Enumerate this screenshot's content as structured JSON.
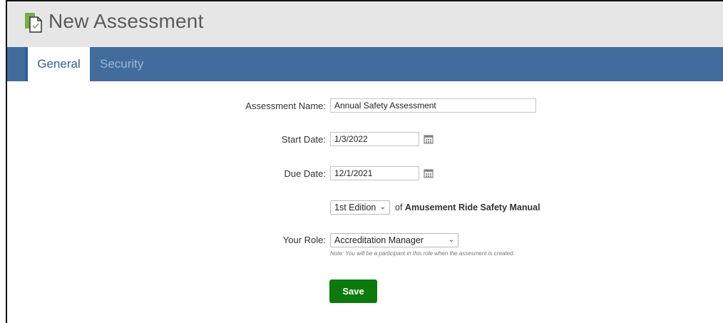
{
  "header": {
    "title": "New Assessment",
    "icon": "document-check-icon"
  },
  "tabs": [
    {
      "label": "General",
      "active": true
    },
    {
      "label": "Security",
      "active": false
    }
  ],
  "form": {
    "assessment_name": {
      "label": "Assessment Name:",
      "value": "Annual Safety Assessment"
    },
    "start_date": {
      "label": "Start Date:",
      "value": "1/3/2022"
    },
    "due_date": {
      "label": "Due Date:",
      "value": "12/1/2021"
    },
    "edition": {
      "selected": "1st Edition",
      "of_text": "of",
      "manual": "Amusement Ride Safety Manual"
    },
    "role": {
      "label": "Your Role:",
      "selected": "Accreditation Manager",
      "note": "Note: You will be a participant in this role when the assesment is created."
    },
    "save_label": "Save"
  },
  "colors": {
    "tab_bar": "#426c9c",
    "save_button": "#0c7a0c",
    "header_bg": "#e6e6e6"
  }
}
